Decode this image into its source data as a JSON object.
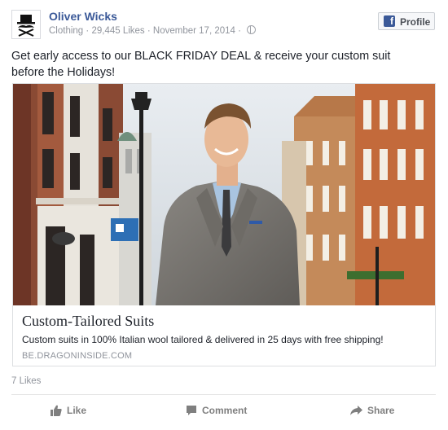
{
  "header": {
    "page_name": "Oliver Wicks",
    "category": "Clothing",
    "likes": "29,445 Likes",
    "date": "November 17, 2014",
    "separator": "·",
    "profile_button": "Profile"
  },
  "post": {
    "text": "Get early access to our BLACK FRIDAY DEAL & receive your custom suit before the Holidays!"
  },
  "link": {
    "title": "Custom-Tailored Suits",
    "description": "Custom suits in 100% Italian wool tailored & delivered in 25 days with free shipping!",
    "domain": "BE.DRAGONINSIDE.COM"
  },
  "footer": {
    "likes_count": "7 Likes",
    "like_label": "Like",
    "comment_label": "Comment",
    "share_label": "Share"
  },
  "icons": {
    "avatar": "top-hat-mustache-logo",
    "profile": "facebook-f-icon",
    "privacy": "globe-icon",
    "like": "thumbs-up-icon",
    "comment": "speech-bubble-icon",
    "share": "share-arrow-icon"
  },
  "colors": {
    "brand": "#3b5998",
    "text": "#1d2129",
    "muted": "#90949c"
  }
}
